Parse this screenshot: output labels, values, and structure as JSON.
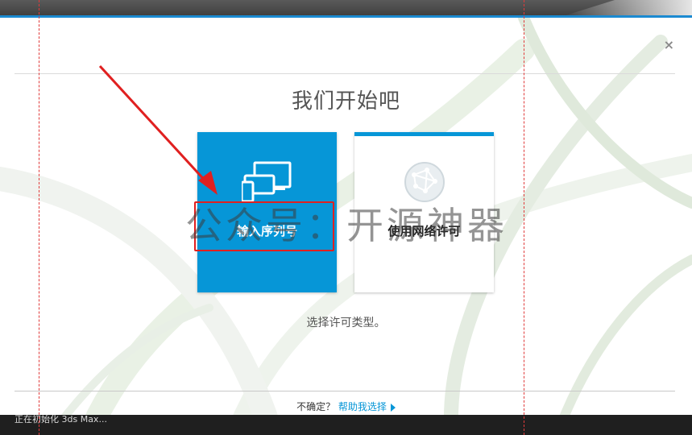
{
  "window": {
    "status_text": "正在初始化 3ds Max..."
  },
  "dialog": {
    "close_glyph": "×",
    "title": "我们开始吧",
    "options": [
      {
        "label": "输入序列号",
        "icon": "devices-icon"
      },
      {
        "label": "使用网络许可",
        "icon": "globe-network-icon"
      }
    ],
    "subtitle": "选择许可类型。",
    "footer": {
      "question": "不确定？",
      "help_link": "帮助我选择"
    }
  },
  "overlay": {
    "watermark": "公众号：开源神器"
  },
  "colors": {
    "accent": "#0696d7",
    "annotation_red": "#e02020"
  }
}
